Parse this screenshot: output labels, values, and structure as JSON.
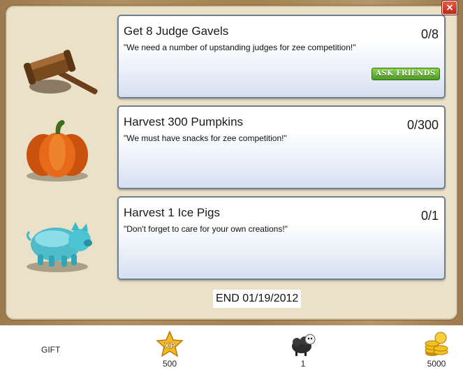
{
  "dialog": {
    "close_label": "×"
  },
  "goals": [
    {
      "title": "Get 8 Judge Gavels",
      "quote": "\"We need a number of upstanding judges for zee competition!\"",
      "progress": "0/8",
      "icon": "gavel-icon",
      "button_label": "ASK FRIENDS"
    },
    {
      "title": "Harvest 300 Pumpkins",
      "quote": "\"We must have snacks for zee competition!\"",
      "progress": "0/300",
      "icon": "pumpkin-icon"
    },
    {
      "title": "Harvest 1 Ice Pigs",
      "quote": "\"Don't forget to care for your own creations!\"",
      "progress": "0/1",
      "icon": "ice-pig-icon"
    }
  ],
  "end_date": "END 01/19/2012",
  "rewards": {
    "gift_label": "GIFT",
    "items": [
      {
        "icon": "xp-star-icon",
        "badge": "XP",
        "value": "500"
      },
      {
        "icon": "sheep-icon",
        "value": "1"
      },
      {
        "icon": "coins-icon",
        "value": "5000"
      }
    ]
  },
  "colors": {
    "card_border": "#6e7f93",
    "ask_button": "#5fae2e",
    "close_button": "#d2402a",
    "frame_wood": "#a98756",
    "panel_bg": "#eae1c8"
  }
}
